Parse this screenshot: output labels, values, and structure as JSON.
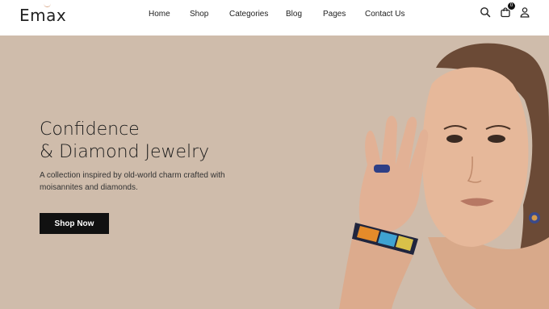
{
  "brand": {
    "name": "Emax"
  },
  "nav": {
    "items": [
      "Home",
      "Shop",
      "Categories",
      "Blog",
      "Pages",
      "Contact Us"
    ]
  },
  "header_icons": {
    "search": "search-icon",
    "cart": "shopping-bag-icon",
    "account": "user-icon",
    "cart_count": "0"
  },
  "hero": {
    "title_line1": "Confidence",
    "title_line2": "& Diamond Jewelry",
    "description": "A collection inspired by old-world charm crafted with moisannites and diamonds.",
    "cta": "Shop Now"
  },
  "colors": {
    "hero_bg": "#cfbcab",
    "button_bg": "#111111",
    "text_dark": "#1b1b1b"
  }
}
